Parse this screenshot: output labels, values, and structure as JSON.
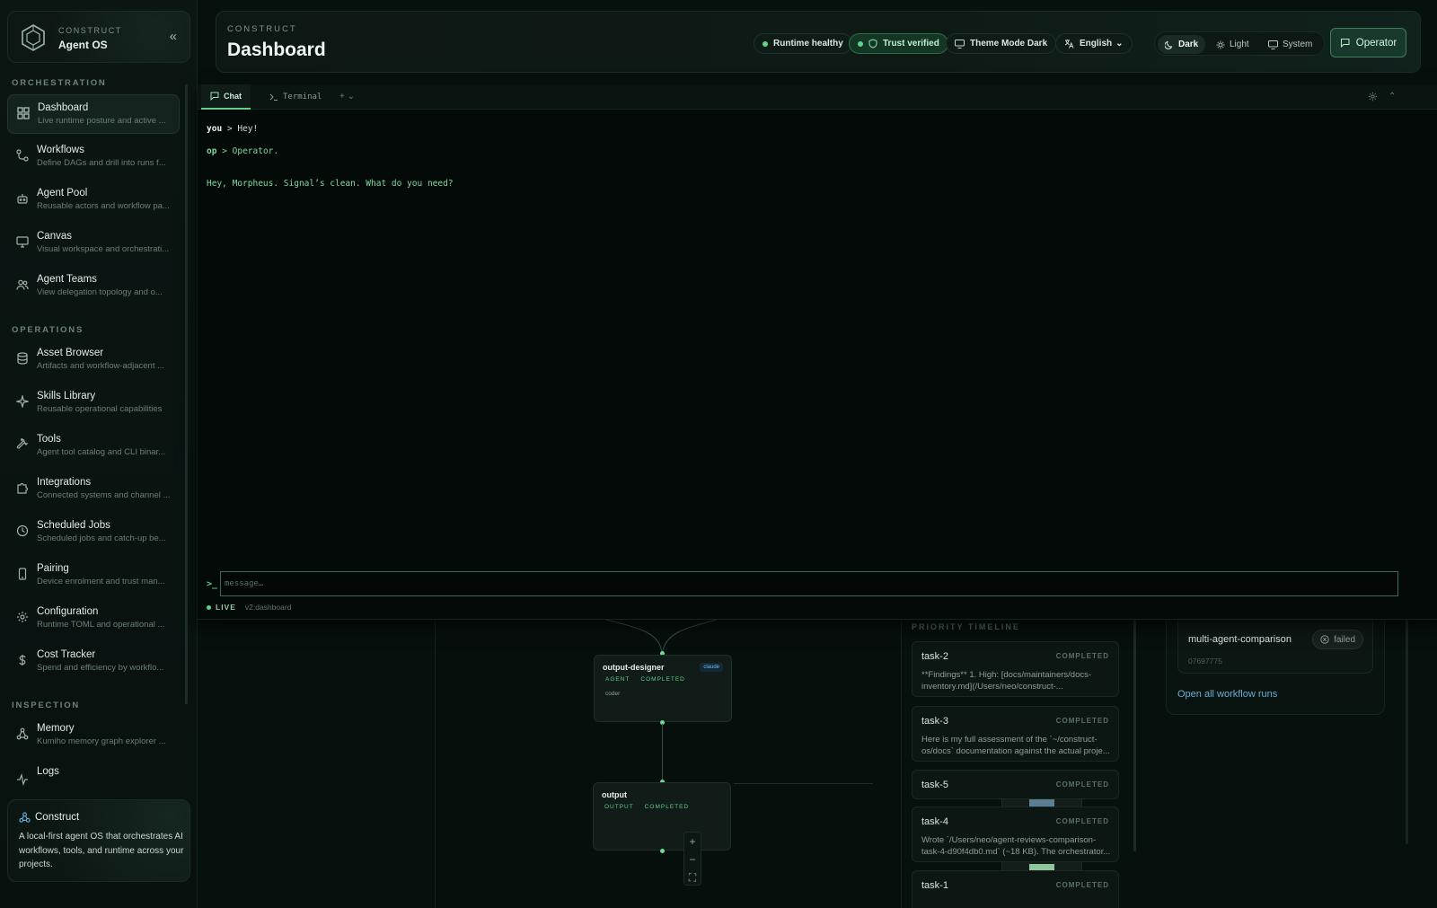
{
  "brand": {
    "kicker": "CONSTRUCT",
    "name": "Agent OS",
    "collapse_icon": "«"
  },
  "sidebar": {
    "sections": [
      {
        "title": "ORCHESTRATION"
      },
      {
        "title": "OPERATIONS"
      },
      {
        "title": "INSPECTION"
      }
    ],
    "items": [
      {
        "label": "Dashboard",
        "desc": "Live runtime posture and active ...",
        "icon": "grid-icon",
        "active": true
      },
      {
        "label": "Workflows",
        "desc": "Define DAGs and drill into runs f...",
        "icon": "workflow-icon"
      },
      {
        "label": "Agent Pool",
        "desc": "Reusable actors and workflow pa...",
        "icon": "bot-icon"
      },
      {
        "label": "Canvas",
        "desc": "Visual workspace and orchestrati...",
        "icon": "monitor-icon"
      },
      {
        "label": "Agent Teams",
        "desc": "View delegation topology and o...",
        "icon": "users-icon"
      },
      {
        "label": "Asset Browser",
        "desc": "Artifacts and workflow-adjacent ...",
        "icon": "database-icon"
      },
      {
        "label": "Skills Library",
        "desc": "Reusable operational capabilities",
        "icon": "sparkle-icon"
      },
      {
        "label": "Tools",
        "desc": "Agent tool catalog and CLI binar...",
        "icon": "wrench-icon"
      },
      {
        "label": "Integrations",
        "desc": "Connected systems and channel ...",
        "icon": "puzzle-icon"
      },
      {
        "label": "Scheduled Jobs",
        "desc": "Scheduled jobs and catch-up be...",
        "icon": "clock-icon"
      },
      {
        "label": "Pairing",
        "desc": "Device enrolment and trust man...",
        "icon": "phone-icon"
      },
      {
        "label": "Configuration",
        "desc": "Runtime TOML and operational ...",
        "icon": "gear-icon"
      },
      {
        "label": "Cost Tracker",
        "desc": "Spend and efficiency by workflo...",
        "icon": "dollar-icon"
      },
      {
        "label": "Memory",
        "desc": "Kumiho memory graph explorer ...",
        "icon": "graph-icon"
      },
      {
        "label": "Logs",
        "desc": "",
        "icon": "activity-icon"
      }
    ],
    "about": {
      "title": "Construct",
      "text": "A local-first agent OS that orchestrates AI workflows, tools, and runtime across your projects."
    }
  },
  "header": {
    "kicker": "CONSTRUCT",
    "title": "Dashboard",
    "status_runtime": "Runtime healthy",
    "status_trust": "Trust verified",
    "theme_mode": "Theme Mode Dark",
    "language": "English",
    "theme_options": [
      "Dark",
      "Light",
      "System"
    ],
    "operator_button": "Operator"
  },
  "chat": {
    "tabs": [
      "Chat",
      "Terminal"
    ],
    "add_tab": "+ ⌄",
    "collapse": "⌃",
    "messages": [
      {
        "who": "you",
        "sep": " > ",
        "text": "Hey!"
      },
      {
        "who": "op",
        "sep": " > ",
        "text": "Operator."
      },
      {
        "who": "",
        "sep": "",
        "text": "Hey, Morpheus. Signal’s clean. What do you need?"
      }
    ],
    "prompt_symbol": ">_",
    "input_placeholder": "message…",
    "live_label": "LIVE",
    "route": "v2:dashboard"
  },
  "workflow": {
    "nodes": [
      {
        "title": "output-designer",
        "tags": [
          "AGENT",
          "COMPLETED"
        ],
        "sub": "coder",
        "badge": "claude"
      },
      {
        "title": "output",
        "tags": [
          "OUTPUT",
          "COMPLETED"
        ],
        "sub": "",
        "badge": ""
      }
    ],
    "zoom": [
      "+",
      "−",
      "⛶"
    ],
    "minimap_colors": [
      "#5c7e8f",
      "#8fc79b",
      "#8fc79b",
      "#4ea0d0",
      "#8fc79b"
    ]
  },
  "timeline": {
    "title": "PRIORITY TIMELINE",
    "tasks": [
      {
        "name": "task-2",
        "status": "COMPLETED",
        "body": "**Findings** 1. High: [docs/maintainers/docs-inventory.md](/Users/neo/construct-..."
      },
      {
        "name": "task-3",
        "status": "COMPLETED",
        "body": "Here is my full assessment of the `~/construct-os/docs` documentation against the actual proje..."
      },
      {
        "name": "task-5",
        "status": "COMPLETED",
        "body": ""
      },
      {
        "name": "task-4",
        "status": "COMPLETED",
        "body": "Wrote `/Users/neo/agent-reviews-comparison-task-4-d90f4db0.md` (~18 KB). The orchestrator..."
      },
      {
        "name": "task-1",
        "status": "COMPLETED",
        "body": ""
      }
    ]
  },
  "runs": {
    "name": "multi-agent-comparison",
    "status": "failed",
    "id": "07697775",
    "link": "Open all workflow runs"
  },
  "colors": {
    "accent": "#5fd38a",
    "link": "#6aaed6",
    "background": "#06100d"
  }
}
